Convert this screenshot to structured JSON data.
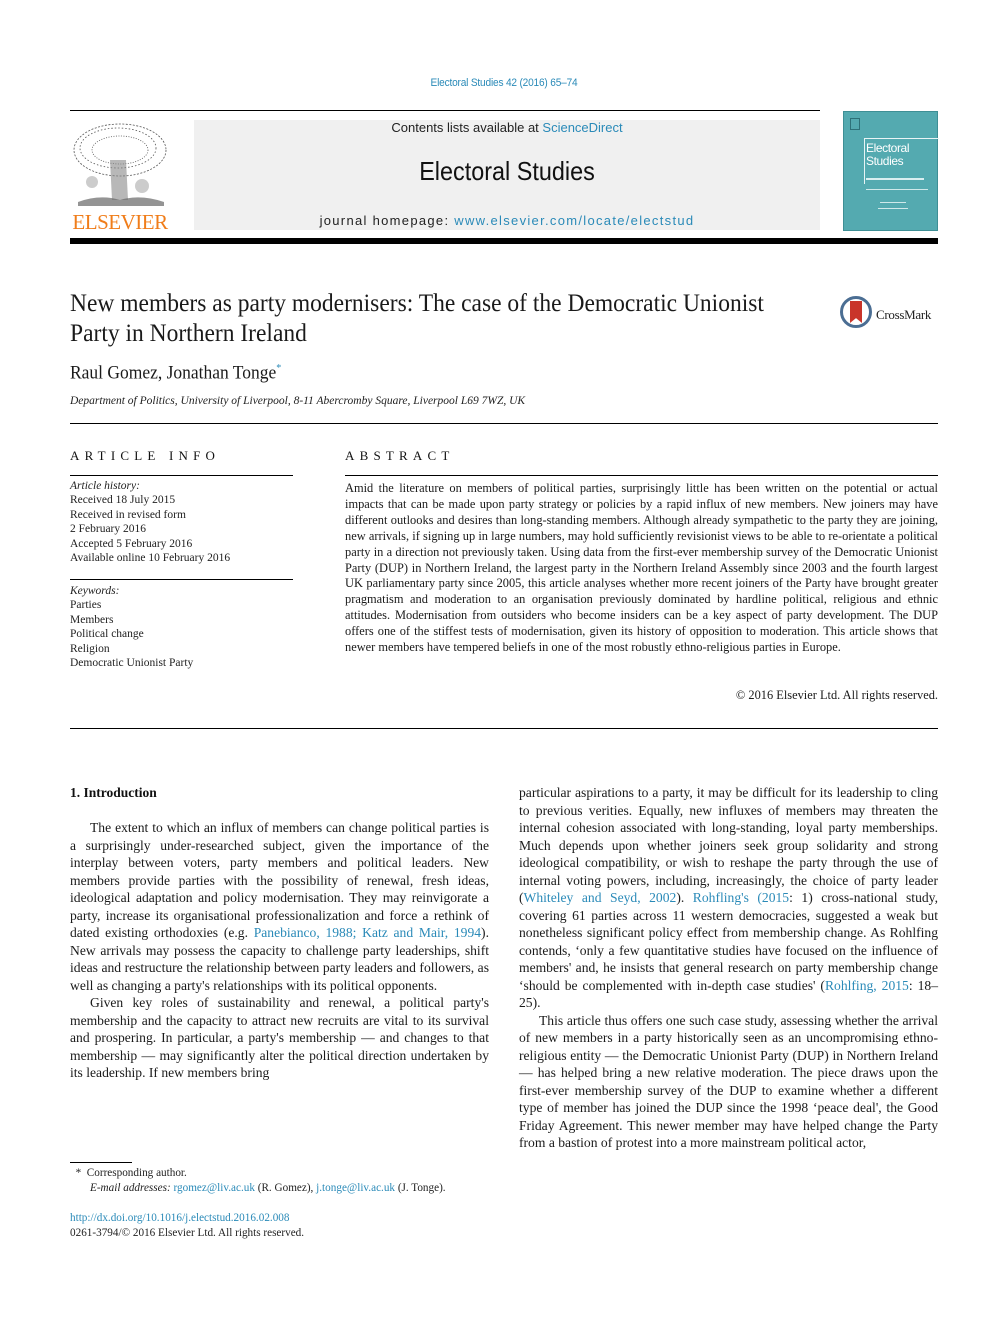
{
  "header": {
    "citation": "Electoral Studies 42 (2016) 65–74",
    "contents_prefix": "Contents lists available at ",
    "contents_link": "ScienceDirect",
    "journal_title": "Electoral Studies",
    "homepage_prefix": "journal homepage: ",
    "homepage_link": "www.elsevier.com/locate/electstud",
    "publisher_logo_text": "ELSEVIER",
    "cover_title_line1": "Electoral",
    "cover_title_line2": "Studies",
    "colors": {
      "link": "#2a8ab8",
      "publisher_orange": "#f07d1a",
      "cover_teal": "#54aab0",
      "header_box_bg": "#f0f0f0"
    }
  },
  "article": {
    "title": "New members as party modernisers: The case of the Democratic Unionist Party in Northern Ireland",
    "crossmark_label": "CrossMark",
    "authors": "Raul Gomez, Jonathan Tonge",
    "corresponding_marker": "*",
    "affiliation": "Department of Politics, University of Liverpool, 8-11 Abercromby Square, Liverpool L69 7WZ, UK"
  },
  "article_info": {
    "heading": "ARTICLE INFO",
    "history_label": "Article history:",
    "history": [
      "Received 18 July 2015",
      "Received in revised form",
      "2 February 2016",
      "Accepted 5 February 2016",
      "Available online 10 February 2016"
    ],
    "keywords_label": "Keywords:",
    "keywords": [
      "Parties",
      "Members",
      "Political change",
      "Religion",
      "Democratic Unionist Party"
    ]
  },
  "abstract": {
    "heading": "ABSTRACT",
    "text": "Amid the literature on members of political parties, surprisingly little has been written on the potential or actual impacts that can be made upon party strategy or policies by a rapid influx of new members. New joiners may have different outlooks and desires than long-standing members. Although already sympathetic to the party they are joining, new arrivals, if signing up in large numbers, may hold suffi­ciently revisionist views to be able to re-orientate a political party in a direction not previously taken. Using data from the first-ever membership survey of the Democratic Unionist Party (DUP) in Northern Ireland, the largest party in the Northern Ireland Assembly since 2003 and the fourth largest UK par­liamentary party since 2005, this article analyses whether more recent joiners of the Party have brought greater pragmatism and moderation to an organisation previously dominated by hardline political, religious and ethnic attitudes. Modernisation from outsiders who become insiders can be a key aspect of party development. The DUP offers one of the stiffest tests of modernisation, given its history of op­position to moderation. This article shows that newer members have tempered beliefs in one of the most robustly ethno-religious parties in Europe.",
    "copyright": "© 2016 Elsevier Ltd. All rights reserved."
  },
  "body": {
    "section_heading": "1.  Introduction",
    "left_p1_a": "The extent to which an influx of members can change political parties is a surprisingly under-researched subject, given the importance of the interplay between voters, party members and political leaders. New members provide parties with the possibility of renewal, fresh ideas, ideological adaptation and policy modernisation. They may reinvigorate a party, increase its organ­isational professionalization and force a rethink of dated existing orthodoxies (e.g. ",
    "left_p1_cite": "Panebianco, 1988; Katz and Mair, 1994",
    "left_p1_b": "). New ar­rivals may possess the capacity to challenge party leaderships, shift ideas and restructure the relationship between party leaders and followers, as well as changing a party's relationships with its po­litical opponents.",
    "left_p2": "Given key roles of sustainability and renewal, a political party's membership and the capacity to attract new recruits are vital to its survival and prospering. In particular, a party's membership — and changes to that membership — may significantly alter the political direction undertaken by its leadership. If new members bring",
    "right_p1_a": "particular aspirations to a party, it may be difficult for its leadership to cling to previous verities. Equally, new influxes of members may threaten the internal cohesion associated with long-standing, loyal party memberships. Much depends upon whether joiners seek group solidarity and strong ideological compatibility, or wish to reshape the party through the use of internal voting powers, including, increasingly, the choice of party leader (",
    "right_p1_cite1": "Whiteley and Seyd, 2002",
    "right_p1_b": "). ",
    "right_p1_cite2": "Rohfling's (2015",
    "right_p1_c": ": 1) cross-national study, covering 61 parties across 11 western democracies, suggested a weak but nonetheless significant policy effect from membership change. As Rohlfing contends, ‘only a few quantitative studies have focused on the influence of members' and, he insists that general research on party membership change ‘should be complemented with in-depth case studies' (",
    "right_p1_cite3": "Rohlfing, 2015",
    "right_p1_d": ": 18–25).",
    "right_p2": "This article thus offers one such case study, assessing whether the arrival of new members in a party historically seen as an uncompromising ethno-religious entity — the Democratic Unionist Party (DUP) in Northern Ireland — has helped bring a new relative moderation. The piece draws upon the first-ever membership survey of the DUP to examine whether a different type of member has joined the DUP since the 1998 ‘peace deal', the Good Friday Agreement. This newer member may have helped change the Party from a bastion of protest into a more mainstream political actor,"
  },
  "footnote": {
    "marker": "*",
    "corresponding": "Corresponding author.",
    "email_label": "E-mail addresses:",
    "email1": "rgomez@liv.ac.uk",
    "email1_name": " (R. Gomez), ",
    "email2": "j.tonge@liv.ac.uk",
    "email2_name": " (J. Tonge).",
    "doi": "http://dx.doi.org/10.1016/j.electstud.2016.02.008",
    "issn_copyright": "0261-3794/© 2016 Elsevier Ltd. All rights reserved."
  }
}
